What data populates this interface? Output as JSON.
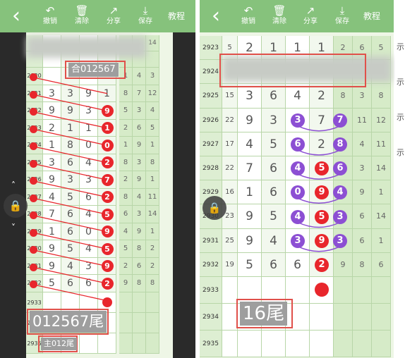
{
  "toolbar": {
    "undo_label": "撤销",
    "clear_label": "清除",
    "share_label": "分享",
    "save_label": "保存",
    "tutorial_label": "教程",
    "back_icon": "back-arrow-icon",
    "undo_icon": "undo-arrow-icon",
    "clear_icon": "trash-icon",
    "share_icon": "share-icon",
    "save_icon": "download-icon"
  },
  "colors": {
    "toolbar": "#86c27c",
    "grid_bg": "#eef6e6",
    "ball_red": "#e8262c",
    "ball_purple": "#8c4fd3",
    "annotation_box": "#e0504a",
    "side_dark": "#2a2a2a"
  },
  "left_panel": {
    "top_partial_numbers": [
      "14",
      "4",
      "12"
    ],
    "annotations": {
      "top_tag": "合012567",
      "prediction_tag": "012567尾",
      "footer_tag": "主012尾"
    },
    "rows": [
      {
        "issue": "2920",
        "digits": [
          "",
          "",
          "",
          ""
        ],
        "ball": "",
        "ext": [
          "1",
          "4",
          "3",
          ""
        ]
      },
      {
        "issue": "2921",
        "digits": [
          "3",
          "3",
          "9",
          "1"
        ],
        "ball": "",
        "ext": [
          "8",
          "7",
          "12",
          ""
        ]
      },
      {
        "issue": "2922",
        "digits": [
          "9",
          "9",
          "3",
          ""
        ],
        "ball": "9",
        "ext": [
          "5",
          "3",
          "4",
          ""
        ]
      },
      {
        "issue": "2923",
        "digits": [
          "2",
          "1",
          "1",
          ""
        ],
        "ball": "1",
        "ext": [
          "2",
          "6",
          "5",
          ""
        ]
      },
      {
        "issue": "2924",
        "digits": [
          "1",
          "8",
          "0",
          ""
        ],
        "ball": "0",
        "ext": [
          "1",
          "9",
          "1",
          ""
        ]
      },
      {
        "issue": "2925",
        "digits": [
          "3",
          "6",
          "4",
          ""
        ],
        "ball": "2",
        "ext": [
          "8",
          "3",
          "8",
          ""
        ]
      },
      {
        "issue": "2926",
        "digits": [
          "9",
          "3",
          "3",
          ""
        ],
        "ball": "7",
        "ext": [
          "2",
          "9",
          "1",
          ""
        ]
      },
      {
        "issue": "2927",
        "digits": [
          "4",
          "5",
          "6",
          ""
        ],
        "ball": "2",
        "ext": [
          "8",
          "4",
          "11",
          ""
        ]
      },
      {
        "issue": "2928",
        "digits": [
          "7",
          "6",
          "4",
          ""
        ],
        "ball": "5",
        "ext": [
          "6",
          "3",
          "14",
          ""
        ]
      },
      {
        "issue": "2929",
        "digits": [
          "1",
          "6",
          "0",
          ""
        ],
        "ball": "9",
        "ext": [
          "4",
          "9",
          "1",
          ""
        ]
      },
      {
        "issue": "2930",
        "digits": [
          "9",
          "5",
          "4",
          ""
        ],
        "ball": "5",
        "ext": [
          "5",
          "8",
          "2",
          ""
        ]
      },
      {
        "issue": "2931",
        "digits": [
          "9",
          "4",
          "3",
          ""
        ],
        "ball": "9",
        "ext": [
          "2",
          "6",
          "2",
          ""
        ]
      },
      {
        "issue": "2932",
        "digits": [
          "5",
          "6",
          "6",
          ""
        ],
        "ball": "2",
        "ext": [
          "9",
          "8",
          "8",
          ""
        ]
      }
    ],
    "footer_issues": [
      "2933",
      "2934",
      "2935"
    ]
  },
  "right_panel": {
    "annotations": {
      "prediction_tag": "16尾"
    },
    "rows": [
      {
        "issue": "2923",
        "sum": "5",
        "d": [
          "2",
          "1",
          "1",
          "1"
        ],
        "ext": [
          "2",
          "6",
          "5"
        ],
        "balls": []
      },
      {
        "issue": "2924",
        "sum": "",
        "d": [
          "",
          "",
          "",
          ""
        ],
        "ext": [
          "",
          "",
          ""
        ],
        "balls": []
      },
      {
        "issue": "2925",
        "sum": "15",
        "d": [
          "3",
          "6",
          "4",
          "2"
        ],
        "ext": [
          "8",
          "3",
          "8"
        ],
        "balls": []
      },
      {
        "issue": "2926",
        "sum": "22",
        "d": [
          "9",
          "3",
          "3",
          "7"
        ],
        "ext": [
          "7",
          "11",
          "12"
        ],
        "balls": [
          {
            "col": 2,
            "v": "3",
            "c": "purple"
          },
          {
            "col": 4,
            "v": "7",
            "c": "purple"
          }
        ]
      },
      {
        "issue": "2927",
        "sum": "17",
        "d": [
          "4",
          "5",
          "6",
          "2"
        ],
        "ext": [
          "8",
          "4",
          "11"
        ],
        "balls": [
          {
            "col": 2,
            "v": "6",
            "c": "purple"
          },
          {
            "col": 4,
            "v": "8",
            "c": "purple"
          }
        ]
      },
      {
        "issue": "2928",
        "sum": "22",
        "d": [
          "7",
          "6",
          "4",
          "5"
        ],
        "ext": [
          "6",
          "3",
          "14"
        ],
        "balls": [
          {
            "col": 2,
            "v": "4",
            "c": "purple"
          },
          {
            "col": 3,
            "v": "5",
            "c": "red"
          },
          {
            "col": 4,
            "v": "6",
            "c": "purple"
          }
        ]
      },
      {
        "issue": "2929",
        "sum": "16",
        "d": [
          "1",
          "6",
          "0",
          "9"
        ],
        "ext": [
          "4",
          "9",
          "1"
        ],
        "balls": [
          {
            "col": 2,
            "v": "0",
            "c": "purple"
          },
          {
            "col": 3,
            "v": "9",
            "c": "red"
          },
          {
            "col": 4,
            "v": "4",
            "c": "purple"
          }
        ]
      },
      {
        "issue": "2930",
        "sum": "23",
        "d": [
          "9",
          "5",
          "4",
          "5"
        ],
        "ext": [
          "3",
          "6",
          "14"
        ],
        "balls": [
          {
            "col": 2,
            "v": "4",
            "c": "purple"
          },
          {
            "col": 3,
            "v": "5",
            "c": "red"
          },
          {
            "col": 4,
            "v": "3",
            "c": "purple"
          }
        ]
      },
      {
        "issue": "2931",
        "sum": "25",
        "d": [
          "9",
          "4",
          "3",
          "9"
        ],
        "ext": [
          "3",
          "6",
          "1"
        ],
        "balls": [
          {
            "col": 2,
            "v": "3",
            "c": "purple"
          },
          {
            "col": 3,
            "v": "9",
            "c": "red"
          },
          {
            "col": 4,
            "v": "3",
            "c": "purple"
          }
        ]
      },
      {
        "issue": "2932",
        "sum": "19",
        "d": [
          "5",
          "6",
          "6",
          "2"
        ],
        "ext": [
          "9",
          "8",
          "6"
        ],
        "balls": [
          {
            "col": 3,
            "v": "2",
            "c": "red"
          }
        ]
      }
    ],
    "footer_issues": [
      "2933",
      "2934",
      "2935"
    ],
    "right_edge_chars": [
      "示",
      "示",
      "示",
      "示"
    ]
  },
  "lock_icon": "lock-icon",
  "arrow_up_icon": "chevron-up-icon",
  "arrow_down_icon": "chevron-down-icon"
}
